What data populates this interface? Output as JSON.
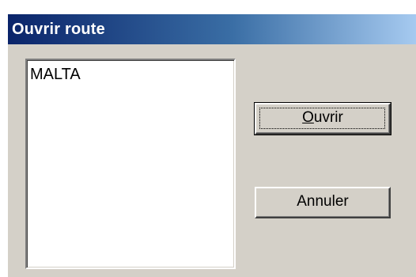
{
  "dialog": {
    "title": "Ouvrir route"
  },
  "list": {
    "items": [
      "MALTA"
    ]
  },
  "buttons": {
    "open": {
      "mnemonic": "O",
      "rest": "uvrir"
    },
    "cancel": {
      "label": "Annuler"
    }
  }
}
